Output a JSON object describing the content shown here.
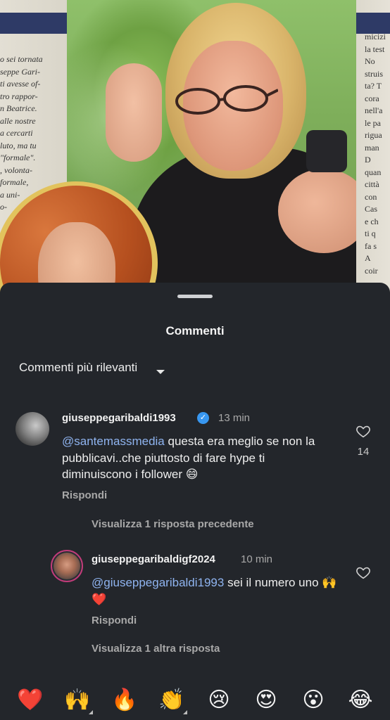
{
  "magazine": {
    "left_text": "o sei tornata\nseppe Gari-\nti avesse of-\ntro rappor-\nn Beatrice.\nalle nostre\na cercarti\nluto, ma tu\n\"formale\".\n, volonta-\nformale,\na uni-\no-",
    "right_text": "micizi\nla test\nNo\nstruis\nta? T\ncora\nnell'a\nle pa\nrigua\nman\nD\nquan\ncittà\ncon\nCas\ne ch\nti q\nfa s\nA\ncoir"
  },
  "sheet": {
    "title": "Commenti",
    "sort_label": "Commenti più rilevanti"
  },
  "comments": [
    {
      "username": "giuseppegaribaldi1993",
      "verified": true,
      "time": "13 min",
      "mention": "@santemassmedia",
      "text": " questa era meglio se non la pubblicavi..che piuttosto di fare hype ti diminuiscono i follower 😄",
      "reply_label": "Rispondi",
      "likes": "14",
      "view_replies": "Visualizza 1 risposta precedente"
    },
    {
      "username": "giuseppegaribaldigf2024",
      "verified": false,
      "time": "10 min",
      "mention": "@giuseppegaribaldi1993",
      "text": " sei il numero uno 🙌❤️",
      "reply_label": "Rispondi",
      "view_replies": "Visualizza 1 altra risposta"
    }
  ],
  "emoji_bar": [
    {
      "glyph": "❤️",
      "name": "heart-emoji",
      "variants": false
    },
    {
      "glyph": "🙌",
      "name": "raised-hands-emoji",
      "variants": true
    },
    {
      "glyph": "🔥",
      "name": "fire-emoji",
      "variants": false
    },
    {
      "glyph": "👏",
      "name": "clapping-emoji",
      "variants": true
    },
    {
      "glyph": "😢",
      "name": "crying-emoji",
      "variants": false
    },
    {
      "glyph": "😍",
      "name": "heart-eyes-emoji",
      "variants": false
    },
    {
      "glyph": "😮",
      "name": "surprised-emoji",
      "variants": false
    },
    {
      "glyph": "😂",
      "name": "laughing-emoji",
      "variants": false
    }
  ],
  "colors": {
    "sheet_bg": "#23262b",
    "mention": "#8fb4f0",
    "verified": "#3897f0",
    "story_ring": "#c23c7a"
  }
}
